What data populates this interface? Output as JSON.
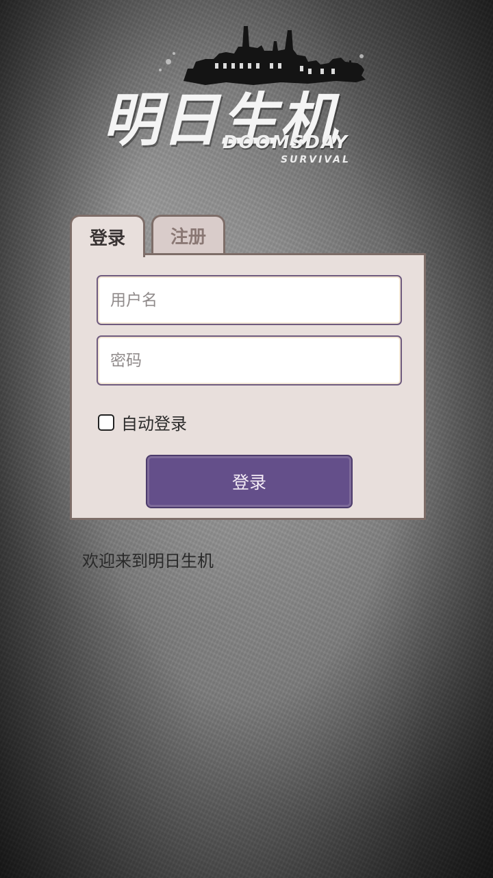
{
  "logo": {
    "title_cn": "明日生机",
    "title_en": "DOOMSDAY",
    "subtitle_en": "SURVIVAL",
    "icon": "ruined-city-skyline-icon"
  },
  "tabs": [
    {
      "label": "登录",
      "active": true
    },
    {
      "label": "注册",
      "active": false
    }
  ],
  "form": {
    "username_placeholder": "用户名",
    "username_value": "",
    "password_placeholder": "密码",
    "password_value": "",
    "auto_login_label": "自动登录",
    "auto_login_checked": false,
    "submit_label": "登录"
  },
  "welcome_text": "欢迎来到明日生机",
  "colors": {
    "accent": "#644f8a",
    "panel": "#e8dfdc",
    "panel_border": "#7d6d68"
  }
}
